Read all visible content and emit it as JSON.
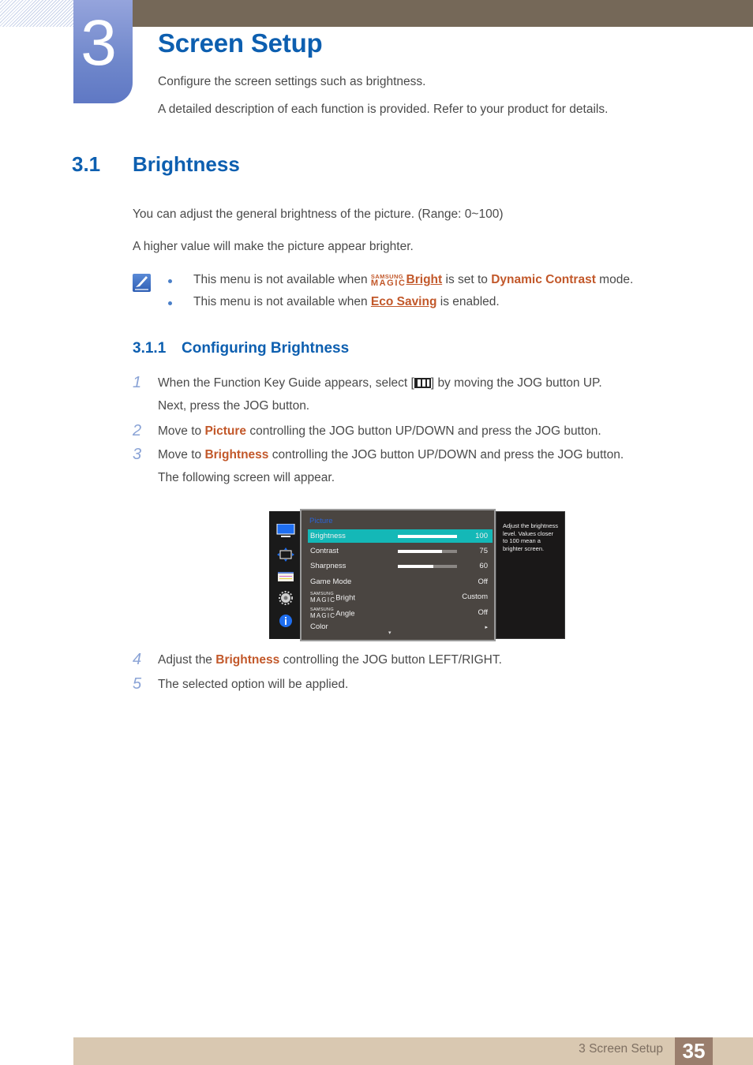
{
  "chapter": {
    "number": "3",
    "title": "Screen Setup",
    "intro": [
      "Configure the screen settings such as brightness.",
      "A detailed description of each function is provided. Refer to your product for details."
    ]
  },
  "section": {
    "number": "3.1",
    "title": "Brightness",
    "paragraphs": [
      "You can adjust the general brightness of the picture. (Range: 0~100)",
      "A higher value will make the picture appear brighter."
    ],
    "notes": {
      "icon": "note-pencil-icon",
      "items": [
        {
          "prefix": "This menu is not available when ",
          "magic_small": "SAMSUNG",
          "magic_large": "MAGIC",
          "link": "Bright",
          "middle": " is set to ",
          "highlight": "Dynamic Contrast",
          "suffix": " mode."
        },
        {
          "prefix": "This menu is not available when ",
          "link": "Eco Saving",
          "suffix": " is enabled."
        }
      ]
    }
  },
  "subsection": {
    "number": "3.1.1",
    "title": "Configuring Brightness",
    "steps": [
      {
        "num": "1",
        "text_before": "When the Function Key Guide appears, select [",
        "icon": "menu-grid-icon",
        "text_after": "] by moving the JOG button UP.",
        "line2": "Next, press the JOG button."
      },
      {
        "num": "2",
        "text_before": "Move to ",
        "highlight": "Picture",
        "text_after": " controlling the JOG button UP/DOWN and press the JOG button."
      },
      {
        "num": "3",
        "text_before": "Move to ",
        "highlight": "Brightness",
        "text_after": " controlling the JOG button UP/DOWN and press the JOG button.",
        "line2": "The following screen will appear."
      },
      {
        "num": "4",
        "text_before": "Adjust the ",
        "highlight": "Brightness",
        "text_after": " controlling the JOG button LEFT/RIGHT."
      },
      {
        "num": "5",
        "text_before": "The selected option will be applied."
      }
    ]
  },
  "osd": {
    "side_icons": [
      "monitor-icon",
      "resize-arrows-icon",
      "color-bars-icon",
      "gear-icon",
      "info-icon"
    ],
    "title": "Picture",
    "rows": [
      {
        "label": "Brightness",
        "value": "100",
        "bar": 100,
        "selected": true
      },
      {
        "label": "Contrast",
        "value": "75",
        "bar": 75
      },
      {
        "label": "Sharpness",
        "value": "60",
        "bar": 60
      },
      {
        "label": "Game Mode",
        "value": "Off"
      },
      {
        "magic_small": "SAMSUNG",
        "magic_large": "MAGIC",
        "label": "Bright",
        "value": "Custom"
      },
      {
        "magic_small": "SAMSUNG",
        "magic_large": "MAGIC",
        "label": "Angle",
        "value": "Off"
      },
      {
        "label": "Color",
        "value": "▸"
      }
    ],
    "scroll_down": "▾",
    "help": "Adjust the brightness level. Values closer to 100 mean a brighter screen."
  },
  "footer": {
    "section": "3 Screen Setup",
    "page": "35"
  },
  "colors": {
    "heading_blue": "#0d5fb0",
    "highlight_orange": "#c2582a",
    "osd_selected": "#14b8b7",
    "top_bar": "#756858",
    "footer_bg": "#d9c8b1",
    "footer_page_bg": "#9a7e6d"
  }
}
